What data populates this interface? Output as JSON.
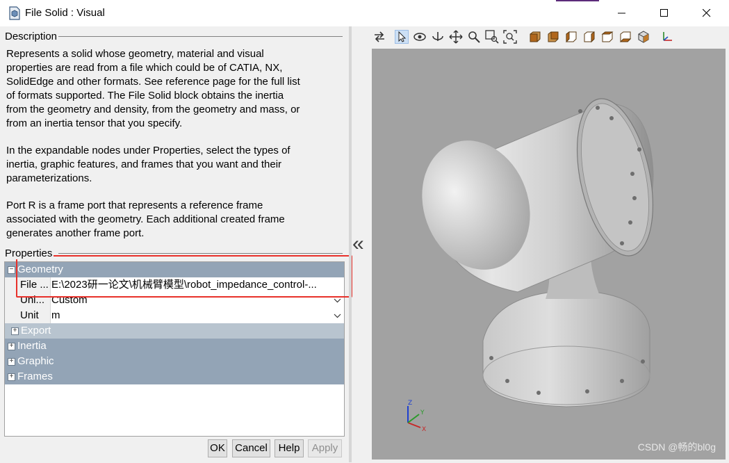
{
  "window": {
    "title": "File Solid : Visual"
  },
  "description": {
    "label": "Description",
    "paragraphs": [
      "Represents a solid whose geometry, material and visual\nproperties are read from a file which could be of CATIA, NX,\nSolidEdge and other formats. See reference page for the full list\nof formats supported. The File Solid block obtains the inertia\nfrom the geometry and density, from the geometry and mass, or\nfrom an inertia tensor that you specify.",
      "In the expandable nodes under Properties, select the types of\ninertia, graphic features, and frames that you want and their\nparameterizations.",
      "Port R is a frame port that represents a reference frame\nassociated with the geometry. Each additional created frame\ngenerates another frame port."
    ]
  },
  "properties": {
    "label": "Properties",
    "geometry": {
      "label": "Geometry",
      "file_name": "File ...",
      "file_value": "E:\\2023研一论文\\机械臂模型\\robot_impedance_control-...",
      "units_name": "Uni...",
      "units_value": "Custom",
      "unit_name": "Unit",
      "unit_value": "m",
      "export_label": "Export"
    },
    "groups": [
      "Inertia",
      "Graphic",
      "Frames"
    ]
  },
  "buttons": {
    "ok": "OK",
    "cancel": "Cancel",
    "help": "Help",
    "apply": "Apply"
  },
  "viewer": {
    "collapse_glyph": "«",
    "watermark": "CSDN @畅的bl0g",
    "triad": {
      "z": "Z",
      "y": "Y",
      "x": "X"
    },
    "toolbar_icons": [
      "swap-icon",
      "select-pointer-icon",
      "rotate-icon",
      "spin-icon",
      "pan-icon",
      "zoom-icon",
      "zoom-box-icon",
      "fit-to-view-icon",
      "view-front-icon",
      "view-back-icon",
      "view-left-icon",
      "view-right-icon",
      "view-top-icon",
      "view-bottom-icon",
      "view-isometric-icon",
      "axes-triad-icon"
    ]
  }
}
